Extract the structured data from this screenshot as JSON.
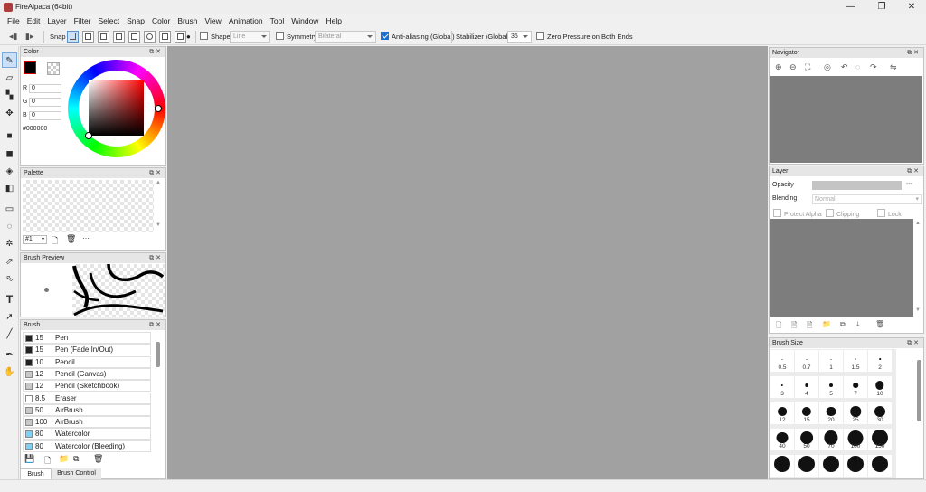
{
  "window": {
    "title": "FireAlpaca (64bit)",
    "minimize": "—",
    "maximize": "❐",
    "close": "✕"
  },
  "menu": [
    "File",
    "Edit",
    "Layer",
    "Filter",
    "Select",
    "Snap",
    "Color",
    "Brush",
    "View",
    "Animation",
    "Tool",
    "Window",
    "Help"
  ],
  "options": {
    "snap_label": "Snap",
    "shape_label": "Shape",
    "shape_value": "Line",
    "symmetry_label": "Symmetry",
    "symmetry_value": "Bilateral",
    "antialias_label": "Anti-aliasing (Global)",
    "antialias_checked": true,
    "stabilizer_label": "Stabilizer (Global)",
    "stabilizer_value": "35",
    "zero_pressure_label": "Zero Pressure on Both Ends"
  },
  "tools": [
    "brush-icon",
    "eraser-icon",
    "dot-icon",
    "move-icon",
    "rect-fill-icon",
    "fill-icon",
    "bucket-icon",
    "gradient-icon",
    "rect-select-icon",
    "lasso-icon",
    "magic-wand-icon",
    "select-pen-icon",
    "select-eraser-icon",
    "text-icon",
    "operation-icon",
    "divide-icon",
    "eyedropper-icon",
    "hand-icon"
  ],
  "color_panel": {
    "title": "Color",
    "r_label": "R",
    "r_value": "0",
    "g_label": "G",
    "g_value": "0",
    "b_label": "B",
    "b_value": "0",
    "hex": "#000000",
    "foreground": "#000000"
  },
  "palette_panel": {
    "title": "Palette",
    "selector": "#1",
    "more": "···"
  },
  "brush_preview_panel": {
    "title": "Brush Preview"
  },
  "brush_panel": {
    "title": "Brush",
    "items": [
      {
        "size": "15",
        "name": "Pen",
        "swatch": "#222222"
      },
      {
        "size": "15",
        "name": "Pen (Fade In/Out)",
        "swatch": "#222222"
      },
      {
        "size": "10",
        "name": "Pencil",
        "swatch": "#222222"
      },
      {
        "size": "12",
        "name": "Pencil (Canvas)",
        "swatch": "#c8c8c8"
      },
      {
        "size": "12",
        "name": "Pencil (Sketchbook)",
        "swatch": "#c8c8c8"
      },
      {
        "size": "8.5",
        "name": "Eraser",
        "swatch": "#ffffff"
      },
      {
        "size": "50",
        "name": "AirBrush",
        "swatch": "#c8c8c8"
      },
      {
        "size": "100",
        "name": "AirBrush",
        "swatch": "#c8c8c8"
      },
      {
        "size": "80",
        "name": "Watercolor",
        "swatch": "#7fd0f2"
      },
      {
        "size": "80",
        "name": "Watercolor (Bleeding)",
        "swatch": "#7fd0f2"
      }
    ],
    "tabs": [
      "Brush",
      "Brush Control"
    ]
  },
  "navigator_panel": {
    "title": "Navigator"
  },
  "layer_panel": {
    "title": "Layer",
    "opacity_label": "Opacity",
    "opacity_more": "---",
    "blending_label": "Blending",
    "blending_value": "Normal",
    "protect_alpha": "Protect Alpha",
    "clipping": "Clipping",
    "lock": "Lock"
  },
  "brush_size_panel": {
    "title": "Brush Size",
    "sizes": [
      "0.5",
      "0.7",
      "1",
      "1.5",
      "2",
      "3",
      "4",
      "5",
      "7",
      "10",
      "12",
      "15",
      "20",
      "25",
      "30",
      "40",
      "50",
      "70",
      "100",
      "150"
    ]
  }
}
